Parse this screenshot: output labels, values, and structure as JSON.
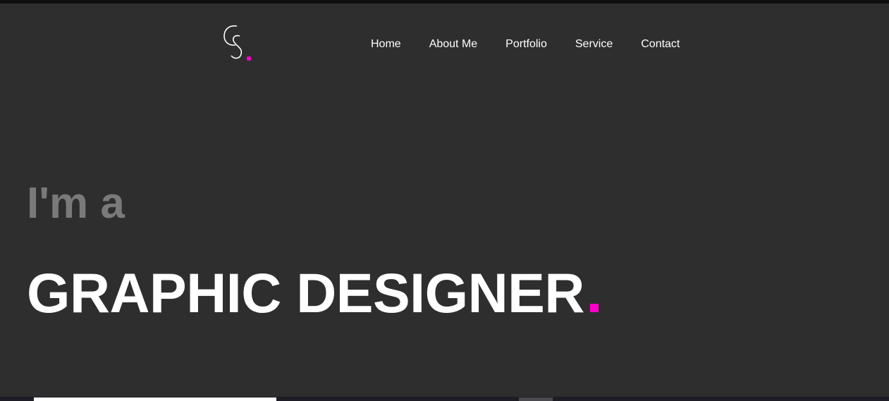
{
  "brand": {
    "logo_icon": "cs-monogram-logo",
    "accent_color": "#ff00cc",
    "background_color": "#2e2e2e"
  },
  "nav": {
    "items": [
      {
        "label": "Home"
      },
      {
        "label": "About Me"
      },
      {
        "label": "Portfolio"
      },
      {
        "label": "Service"
      },
      {
        "label": "Contact"
      }
    ]
  },
  "hero": {
    "intro": "I'm a",
    "headline": "GRAPHIC DESIGNER"
  }
}
